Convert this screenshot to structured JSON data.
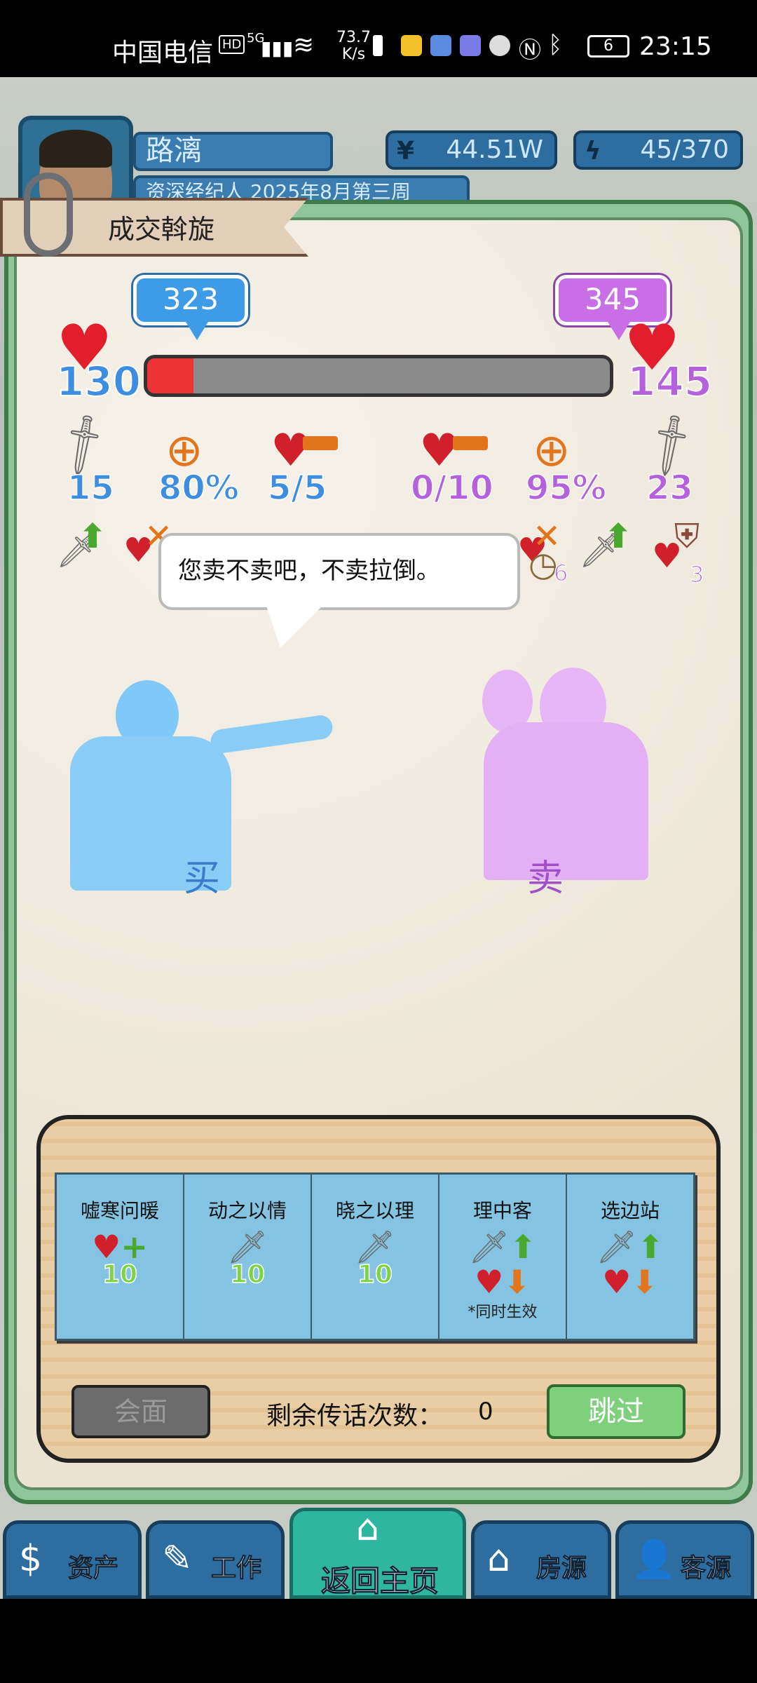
{
  "status_bar": {
    "carrier": "中国电信",
    "signal": "5G",
    "net_speed_value": "73.7",
    "net_speed_unit": "K/s",
    "battery": "6",
    "time": "23:15"
  },
  "header": {
    "player_name": "路漓",
    "subtitle": "资深经纪人 2025年8月第三周",
    "money": "44.51W",
    "energy": "45/370"
  },
  "panel": {
    "title": "成交斡旋"
  },
  "buyer": {
    "score": "323",
    "hp": "130",
    "attack": "15",
    "accuracy": "80%",
    "lives": "5/5",
    "role_label": "买"
  },
  "seller": {
    "score": "345",
    "hp": "145",
    "attack": "23",
    "accuracy": "95%",
    "lives": "0/10",
    "timer_count": "6",
    "shield_count": "3",
    "role_label": "卖"
  },
  "progress": {
    "buyer_fill_fraction": 0.1
  },
  "speech": "您卖不卖吧，不卖拉倒。",
  "cards": [
    {
      "title": "嘘寒问暖",
      "value": "10",
      "icons": "heart-plus-icon"
    },
    {
      "title": "动之以情",
      "value": "10",
      "icons": "sword-icon"
    },
    {
      "title": "晓之以理",
      "value": "10",
      "icons": "sword-icon"
    },
    {
      "title": "理中客",
      "value": "",
      "icons": "sword-up-heart-down-icon",
      "note": "*同时生效"
    },
    {
      "title": "选边站",
      "value": "",
      "icons": "sword-up-heart-down-icon"
    }
  ],
  "actions": {
    "meet_label": "会面",
    "remaining_label": "剩余传话次数：",
    "remaining_value": "0",
    "skip_label": "跳过"
  },
  "nav": {
    "assets": "资产",
    "work": "工作",
    "home": "返回主页",
    "listings": "房源",
    "clients": "客源"
  },
  "colors": {
    "buyer": "#3d8de0",
    "seller": "#b561de",
    "panel_border": "#3f7a49",
    "card_bg": "#84c4e2",
    "skip_button": "#7ed07c"
  }
}
